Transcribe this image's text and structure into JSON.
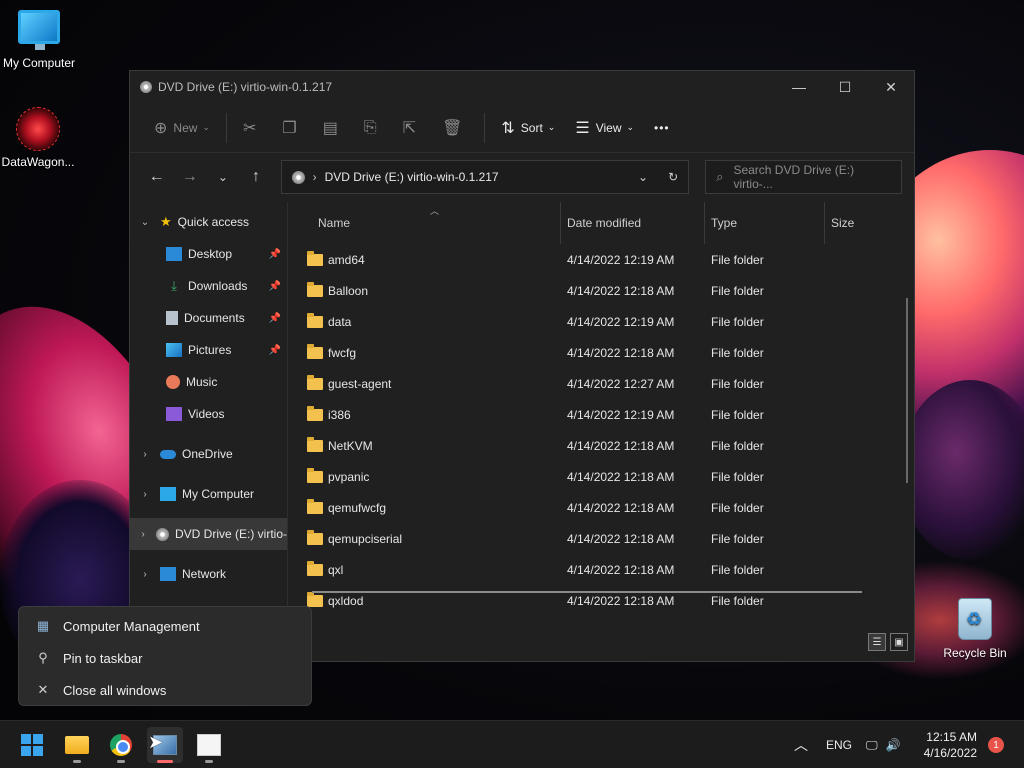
{
  "desktop": {
    "icons": [
      {
        "label": "My Computer"
      },
      {
        "label": "DataWagon..."
      },
      {
        "label": "Recycle Bin"
      }
    ]
  },
  "window": {
    "title": "DVD Drive (E:) virtio-win-0.1.217",
    "controls": {
      "minimize": "—",
      "maximize": "☐",
      "close": "✕"
    },
    "toolbar": {
      "new_label": "New",
      "sort_label": "Sort",
      "view_label": "View",
      "more_label": "•••"
    },
    "address": "DVD Drive (E:) virtio-win-0.1.217",
    "search_placeholder": "Search DVD Drive (E:) virtio-...",
    "sidebar": {
      "quick_access": "Quick access",
      "items": [
        {
          "label": "Desktop",
          "icon": "desktop-icon",
          "pinned": true
        },
        {
          "label": "Downloads",
          "icon": "download-icon",
          "pinned": true
        },
        {
          "label": "Documents",
          "icon": "document-icon",
          "pinned": true
        },
        {
          "label": "Pictures",
          "icon": "pictures-icon",
          "pinned": true
        },
        {
          "label": "Music",
          "icon": "music-icon",
          "pinned": false
        },
        {
          "label": "Videos",
          "icon": "videos-icon",
          "pinned": false
        }
      ],
      "onedrive": "OneDrive",
      "my_computer": "My Computer",
      "dvd": "DVD Drive (E:) virtio-",
      "network": "Network"
    },
    "columns": {
      "name": "Name",
      "date": "Date modified",
      "type": "Type",
      "size": "Size"
    },
    "files": [
      {
        "name": "amd64",
        "date": "4/14/2022 12:19 AM",
        "type": "File folder"
      },
      {
        "name": "Balloon",
        "date": "4/14/2022 12:18 AM",
        "type": "File folder"
      },
      {
        "name": "data",
        "date": "4/14/2022 12:19 AM",
        "type": "File folder"
      },
      {
        "name": "fwcfg",
        "date": "4/14/2022 12:18 AM",
        "type": "File folder"
      },
      {
        "name": "guest-agent",
        "date": "4/14/2022 12:27 AM",
        "type": "File folder"
      },
      {
        "name": "i386",
        "date": "4/14/2022 12:19 AM",
        "type": "File folder"
      },
      {
        "name": "NetKVM",
        "date": "4/14/2022 12:18 AM",
        "type": "File folder"
      },
      {
        "name": "pvpanic",
        "date": "4/14/2022 12:18 AM",
        "type": "File folder"
      },
      {
        "name": "qemufwcfg",
        "date": "4/14/2022 12:18 AM",
        "type": "File folder"
      },
      {
        "name": "qemupciserial",
        "date": "4/14/2022 12:18 AM",
        "type": "File folder"
      },
      {
        "name": "qxl",
        "date": "4/14/2022 12:18 AM",
        "type": "File folder"
      },
      {
        "name": "qxldod",
        "date": "4/14/2022 12:18 AM",
        "type": "File folder"
      }
    ]
  },
  "context_menu": {
    "items": [
      {
        "label": "Computer Management",
        "icon": "computer-management-icon"
      },
      {
        "label": "Pin to taskbar",
        "icon": "pin-icon"
      },
      {
        "label": "Close all windows",
        "icon": "close-icon"
      }
    ]
  },
  "taskbar": {
    "language": "ENG",
    "time": "12:15 AM",
    "date": "4/16/2022",
    "notification_count": "1"
  },
  "colors": {
    "accent": "#3aa4ee",
    "folder": "#f2c14e",
    "notification": "#e8544a"
  }
}
